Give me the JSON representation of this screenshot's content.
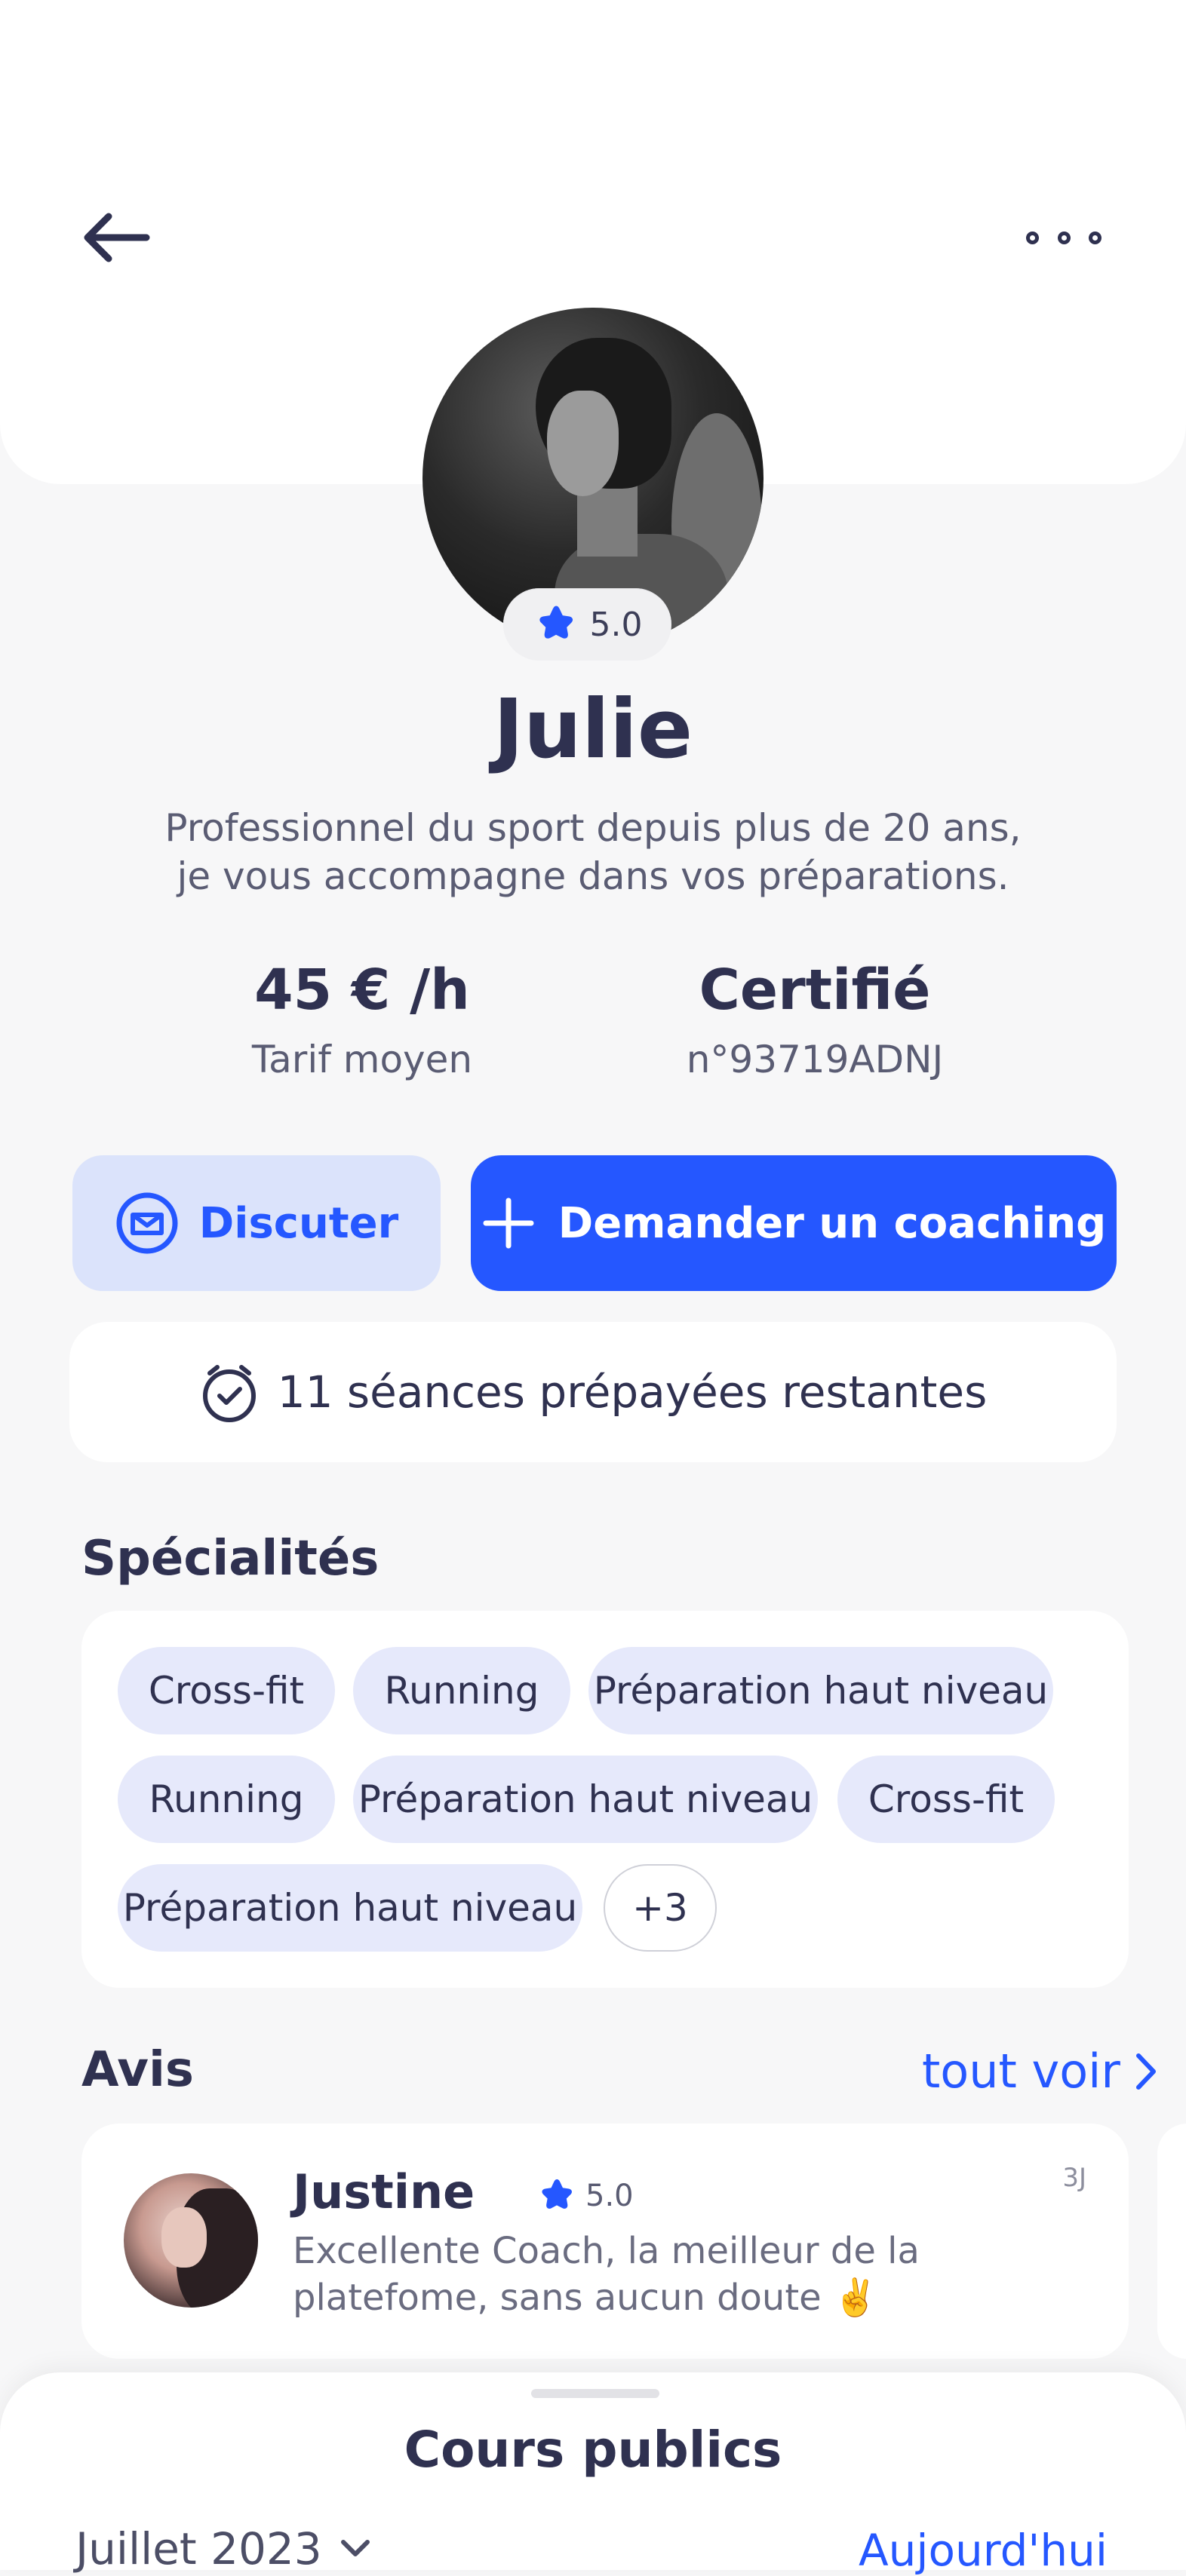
{
  "header": {
    "back_icon": "arrow-left-icon",
    "more_icon": "more-dots-icon"
  },
  "profile": {
    "name": "Julie",
    "rating": "5.0",
    "bio_line1": "Professionnel du sport depuis plus de 20 ans,",
    "bio_line2": "je vous accompagne dans vos préparations.",
    "rate_value": "45 € /h",
    "rate_label": "Tarif moyen",
    "cert_value": "Certifié",
    "cert_label": "n°93719ADNJ"
  },
  "actions": {
    "chat_label": "Discuter",
    "coach_label": "Demander un coaching",
    "sessions_label": "11 séances prépayées restantes"
  },
  "specialties": {
    "title": "Spécialités",
    "chips": [
      "Cross-fit",
      "Running",
      "Préparation haut niveau",
      "Running",
      "Préparation haut niveau",
      "Cross-fit",
      "Préparation haut niveau"
    ],
    "more_label": "+3"
  },
  "reviews": {
    "title": "Avis",
    "see_all": "tout voir",
    "items": [
      {
        "name": "Justine",
        "rating": "5.0",
        "time": "3J",
        "text": "Excellente Coach, la meilleur de la platefome, sans aucun doute ✌️"
      }
    ]
  },
  "public_courses": {
    "title": "Cours publics",
    "month": "Juillet 2023",
    "today": "Aujourd'hui"
  },
  "colors": {
    "accent": "#2557ff",
    "accent_light": "#dbe3fb",
    "chip": "#e6e9fb",
    "text": "#2f3150"
  }
}
